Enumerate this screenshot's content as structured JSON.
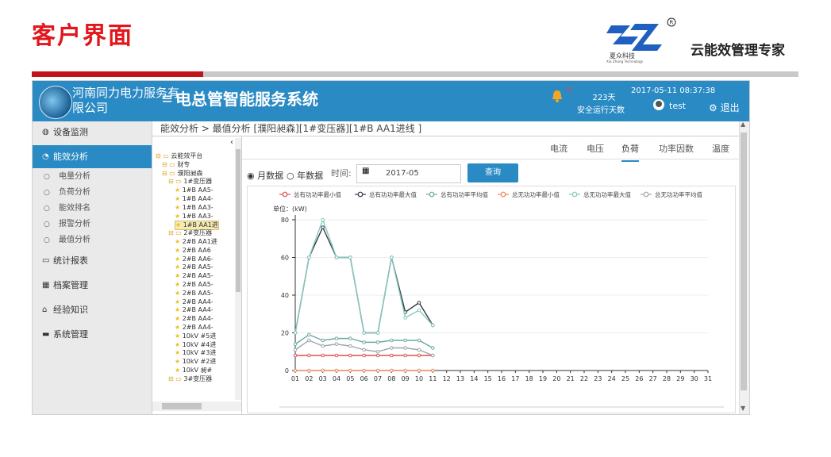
{
  "slide": {
    "title": "客户界面",
    "brand_cn": "夏众科技",
    "brand_en": "Xia Zhong Technology",
    "slogan": "云能效管理专家"
  },
  "app": {
    "company": "河南同力电力服务有限公司",
    "menu_icon": "≡",
    "system_title": "电总管智能服务系统",
    "alert_count": "0",
    "run_days": "223天",
    "run_label": "安全运行天数",
    "datetime": "2017-05-11 08:37:38",
    "user": "test",
    "logout": "退出"
  },
  "sidebar": {
    "items": [
      {
        "icon": "dashboard-icon",
        "glyph": "◍",
        "label": "设备监测"
      },
      {
        "icon": "energy-icon",
        "glyph": "◔",
        "label": "能效分析"
      },
      {
        "icon": "monitor-icon",
        "glyph": "▭",
        "label": "统计报表"
      },
      {
        "icon": "table-icon",
        "glyph": "▦",
        "label": "档案管理"
      },
      {
        "icon": "home-icon",
        "glyph": "⌂",
        "label": "经验知识"
      },
      {
        "icon": "folder-icon",
        "glyph": "▬",
        "label": "系统管理"
      }
    ],
    "subitems": [
      "电量分析",
      "负荷分析",
      "能效排名",
      "报警分析",
      "最值分析"
    ]
  },
  "breadcrumb": "能效分析 > 最值分析 [濮阳昶森][1#变压器][1#B AA1进线 ]",
  "tree": [
    {
      "label": "云能效平台",
      "level": 0,
      "type": "folder"
    },
    {
      "label": "财专",
      "level": 1,
      "type": "folder"
    },
    {
      "label": "濮阳昶森",
      "level": 1,
      "type": "folder"
    },
    {
      "label": "1#变压器",
      "level": 2,
      "type": "folder"
    },
    {
      "label": "1#B AA5-",
      "level": 3,
      "type": "star"
    },
    {
      "label": "1#B AA4-",
      "level": 3,
      "type": "star"
    },
    {
      "label": "1#B AA3-",
      "level": 3,
      "type": "star"
    },
    {
      "label": "1#B AA3-",
      "level": 3,
      "type": "star"
    },
    {
      "label": "1#B AA1进",
      "level": 3,
      "type": "star",
      "selected": true
    },
    {
      "label": "2#变压器",
      "level": 2,
      "type": "folder"
    },
    {
      "label": "2#B AA1进",
      "level": 3,
      "type": "star"
    },
    {
      "label": "2#B AA6",
      "level": 3,
      "type": "star"
    },
    {
      "label": "2#B AA6-",
      "level": 3,
      "type": "star"
    },
    {
      "label": "2#B AA5-",
      "level": 3,
      "type": "star"
    },
    {
      "label": "2#B AA5-",
      "level": 3,
      "type": "star"
    },
    {
      "label": "2#B AA5-",
      "level": 3,
      "type": "star"
    },
    {
      "label": "2#B AA5-",
      "level": 3,
      "type": "star"
    },
    {
      "label": "2#B AA4-",
      "level": 3,
      "type": "star"
    },
    {
      "label": "2#B AA4-",
      "level": 3,
      "type": "star"
    },
    {
      "label": "2#B AA4-",
      "level": 3,
      "type": "star"
    },
    {
      "label": "2#B AA4-",
      "level": 3,
      "type": "star"
    },
    {
      "label": "10kV #5进",
      "level": 3,
      "type": "star"
    },
    {
      "label": "10kV #4进",
      "level": 3,
      "type": "star"
    },
    {
      "label": "10kV #3进",
      "level": 3,
      "type": "star"
    },
    {
      "label": "10kV #2进",
      "level": 3,
      "type": "star"
    },
    {
      "label": "10kV 昶#",
      "level": 3,
      "type": "star"
    },
    {
      "label": "3#变压器",
      "level": 2,
      "type": "folder"
    }
  ],
  "tabs": [
    "电流",
    "电压",
    "负荷",
    "功率因数",
    "温度"
  ],
  "active_tab": 2,
  "controls": {
    "radio_month": "月数据",
    "radio_year": "年数据",
    "time_label": "时间:",
    "date_value": "2017-05",
    "query_button": "查询"
  },
  "chart_data": {
    "type": "line",
    "unit_label": "单位：(kW)",
    "x": [
      "01",
      "02",
      "03",
      "04",
      "05",
      "06",
      "07",
      "08",
      "09",
      "10",
      "11",
      "12",
      "13",
      "14",
      "15",
      "16",
      "17",
      "18",
      "19",
      "20",
      "21",
      "22",
      "23",
      "24",
      "25",
      "26",
      "27",
      "28",
      "29",
      "30",
      "31"
    ],
    "ylim": [
      0,
      80
    ],
    "yticks": [
      0,
      20,
      40,
      60,
      80
    ],
    "series": [
      {
        "name": "总有功功率最小值",
        "color": "#d9534f",
        "values": [
          8,
          8,
          8,
          8,
          8,
          8,
          8,
          8,
          8,
          8,
          8
        ]
      },
      {
        "name": "总有功功率最大值",
        "color": "#2f3a44",
        "values": [
          20,
          60,
          76,
          60,
          60,
          20,
          20,
          60,
          31,
          36,
          24
        ]
      },
      {
        "name": "总有功功率平均值",
        "color": "#6aaba0",
        "values": [
          14,
          19,
          16,
          17,
          17,
          15,
          15,
          16,
          16,
          16,
          12
        ]
      },
      {
        "name": "总无功功率最小值",
        "color": "#e8865a",
        "values": [
          0,
          0,
          0,
          0,
          0,
          0,
          0,
          0,
          0,
          0,
          0
        ]
      },
      {
        "name": "总无功功率最大值",
        "color": "#87c8bf",
        "values": [
          20,
          60,
          80,
          60,
          60,
          20,
          20,
          60,
          28,
          32,
          24
        ]
      },
      {
        "name": "总无功功率平均值",
        "color": "#9aa6ae",
        "values": [
          11,
          16,
          13,
          14,
          13,
          11,
          10,
          12,
          12,
          11,
          8
        ]
      }
    ]
  }
}
